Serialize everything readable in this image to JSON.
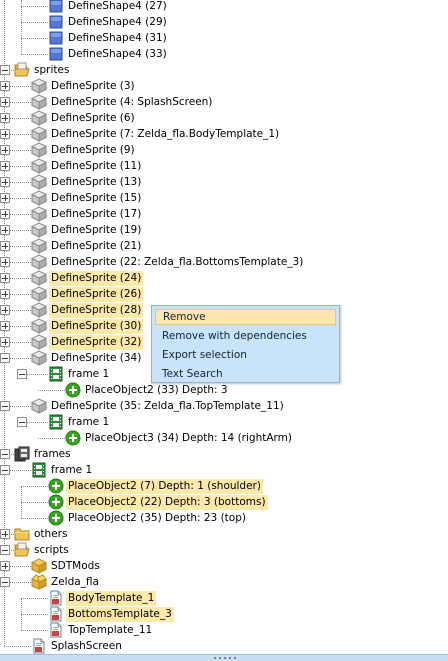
{
  "tree_rows": [
    {
      "indent": 2,
      "icon": "shape",
      "text": "DefineShape4 (27)"
    },
    {
      "indent": 2,
      "icon": "shape",
      "text": "DefineShape4 (29)"
    },
    {
      "indent": 2,
      "icon": "shape",
      "text": "DefineShape4 (31)"
    },
    {
      "indent": 2,
      "icon": "shape",
      "text": "DefineShape4 (33)"
    },
    {
      "indent": 0,
      "icon": "folder-open",
      "text": "sprites",
      "toggle": "minus"
    },
    {
      "indent": 1,
      "icon": "sprite",
      "text": "DefineSprite (3)",
      "toggle": "plus"
    },
    {
      "indent": 1,
      "icon": "sprite",
      "text": "DefineSprite (4: SplashScreen)",
      "toggle": "plus"
    },
    {
      "indent": 1,
      "icon": "sprite",
      "text": "DefineSprite (6)",
      "toggle": "plus"
    },
    {
      "indent": 1,
      "icon": "sprite",
      "text": "DefineSprite (7: Zelda_fla.BodyTemplate_1)",
      "toggle": "plus"
    },
    {
      "indent": 1,
      "icon": "sprite",
      "text": "DefineSprite (9)",
      "toggle": "plus"
    },
    {
      "indent": 1,
      "icon": "sprite",
      "text": "DefineSprite (11)",
      "toggle": "plus"
    },
    {
      "indent": 1,
      "icon": "sprite",
      "text": "DefineSprite (13)",
      "toggle": "plus"
    },
    {
      "indent": 1,
      "icon": "sprite",
      "text": "DefineSprite (15)",
      "toggle": "plus"
    },
    {
      "indent": 1,
      "icon": "sprite",
      "text": "DefineSprite (17)",
      "toggle": "plus"
    },
    {
      "indent": 1,
      "icon": "sprite",
      "text": "DefineSprite (19)",
      "toggle": "plus"
    },
    {
      "indent": 1,
      "icon": "sprite",
      "text": "DefineSprite (21)",
      "toggle": "plus"
    },
    {
      "indent": 1,
      "icon": "sprite",
      "text": "DefineSprite (22: Zelda_fla.BottomsTemplate_3)",
      "toggle": "plus"
    },
    {
      "indent": 1,
      "icon": "sprite",
      "text": "DefineSprite (24)",
      "toggle": "plus",
      "highlight": true
    },
    {
      "indent": 1,
      "icon": "sprite",
      "text": "DefineSprite (26)",
      "toggle": "plus",
      "highlight": true
    },
    {
      "indent": 1,
      "icon": "sprite",
      "text": "DefineSprite (28)",
      "toggle": "plus",
      "highlight": true
    },
    {
      "indent": 1,
      "icon": "sprite",
      "text": "DefineSprite (30)",
      "toggle": "plus",
      "highlight": true
    },
    {
      "indent": 1,
      "icon": "sprite",
      "text": "DefineSprite (32)",
      "toggle": "plus",
      "highlight": true
    },
    {
      "indent": 1,
      "icon": "sprite",
      "text": "DefineSprite (34)",
      "toggle": "minus"
    },
    {
      "indent": 2,
      "icon": "frame",
      "text": "frame 1",
      "toggle": "minus"
    },
    {
      "indent": 3,
      "icon": "place",
      "text": "PlaceObject2 (33) Depth: 3"
    },
    {
      "indent": 1,
      "icon": "sprite",
      "text": "DefineSprite (35: Zelda_fla.TopTemplate_11)",
      "toggle": "minus"
    },
    {
      "indent": 2,
      "icon": "frame",
      "text": "frame 1",
      "toggle": "minus"
    },
    {
      "indent": 3,
      "icon": "place",
      "text": "PlaceObject3 (34) Depth: 14 (rightArm)"
    },
    {
      "indent": 0,
      "icon": "frames",
      "text": "frames",
      "toggle": "minus"
    },
    {
      "indent": 1,
      "icon": "frame",
      "text": "frame 1",
      "toggle": "minus"
    },
    {
      "indent": 2,
      "icon": "place",
      "text": "PlaceObject2 (7) Depth: 1 (shoulder)",
      "highlight": true
    },
    {
      "indent": 2,
      "icon": "place",
      "text": "PlaceObject2 (22) Depth: 3 (bottoms)",
      "highlight": true
    },
    {
      "indent": 2,
      "icon": "place",
      "text": "PlaceObject2 (35) Depth: 23 (top)"
    },
    {
      "indent": 0,
      "icon": "folder-closed",
      "text": "others",
      "toggle": "plus"
    },
    {
      "indent": 0,
      "icon": "folder-open",
      "text": "scripts",
      "toggle": "minus"
    },
    {
      "indent": 1,
      "icon": "package",
      "text": "SDTMods",
      "toggle": "plus"
    },
    {
      "indent": 1,
      "icon": "package-open",
      "text": "Zelda_fla",
      "toggle": "minus"
    },
    {
      "indent": 2,
      "icon": "script",
      "text": "BodyTemplate_1",
      "highlight": true
    },
    {
      "indent": 2,
      "icon": "script",
      "text": "BottomsTemplate_3",
      "highlight": true
    },
    {
      "indent": 2,
      "icon": "script",
      "text": "TopTemplate_11"
    },
    {
      "indent": 1,
      "icon": "script",
      "text": "SplashScreen"
    }
  ],
  "context_menu": {
    "items": [
      {
        "label": "Remove",
        "active": true
      },
      {
        "label": "Remove with dependencies"
      },
      {
        "label": "Export selection"
      },
      {
        "label": "Text Search"
      }
    ]
  },
  "colors": {
    "selection_highlight": "#fde9a8",
    "menu_background": "#c9e3fb",
    "menu_active": "#fbe6b0",
    "shape_icon": "#4f78d8",
    "place_icon": "#3aa521",
    "folder_icon": "#f2c451"
  }
}
